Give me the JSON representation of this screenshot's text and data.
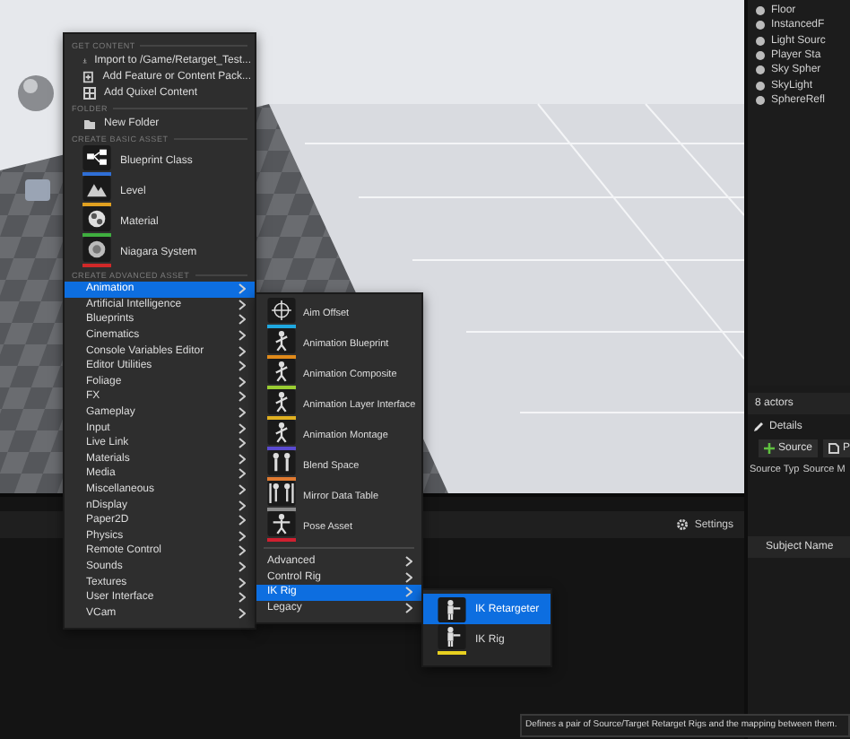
{
  "outliner": {
    "items": [
      {
        "label": "Floor"
      },
      {
        "label": "InstancedF"
      },
      {
        "label": "Light Sourc"
      },
      {
        "label": "Player Sta"
      },
      {
        "label": "Sky Spher"
      },
      {
        "label": "SkyLight"
      },
      {
        "label": "SphereRefl"
      }
    ]
  },
  "details": {
    "actor_count": "8 actors",
    "tab": "Details",
    "buttons": [
      "Source",
      "P"
    ],
    "columns": [
      "Source Typ",
      "Source M"
    ],
    "subject_header": "Subject Name"
  },
  "bottom_panel": {
    "settings": "Settings"
  },
  "context_menu": {
    "sections": [
      {
        "header": "GET CONTENT",
        "items": [
          {
            "kind": "action",
            "label": "Import to /Game/Retarget_Test..."
          },
          {
            "kind": "action",
            "label": "Add Feature or Content Pack..."
          },
          {
            "kind": "action",
            "label": "Add Quixel Content"
          }
        ]
      },
      {
        "header": "FOLDER",
        "items": [
          {
            "kind": "action",
            "label": "New Folder"
          }
        ]
      },
      {
        "header": "CREATE BASIC ASSET",
        "items": [
          {
            "kind": "asset",
            "label": "Blueprint Class",
            "color": "#2f6fd6"
          },
          {
            "kind": "asset",
            "label": "Level",
            "color": "#e0a020"
          },
          {
            "kind": "asset",
            "label": "Material",
            "color": "#3fae3f"
          },
          {
            "kind": "asset",
            "label": "Niagara System",
            "color": "#d02828"
          }
        ]
      },
      {
        "header": "CREATE ADVANCED ASSET",
        "items": [
          {
            "kind": "category",
            "label": "Animation",
            "selected": true
          },
          {
            "kind": "category",
            "label": "Artificial Intelligence",
            "selected": false
          },
          {
            "kind": "category",
            "label": "Blueprints",
            "selected": false
          },
          {
            "kind": "category",
            "label": "Cinematics",
            "selected": false
          },
          {
            "kind": "category",
            "label": "Console Variables Editor",
            "selected": false
          },
          {
            "kind": "category",
            "label": "Editor Utilities",
            "selected": false
          },
          {
            "kind": "category",
            "label": "Foliage",
            "selected": false
          },
          {
            "kind": "category",
            "label": "FX",
            "selected": false
          },
          {
            "kind": "category",
            "label": "Gameplay",
            "selected": false
          },
          {
            "kind": "category",
            "label": "Input",
            "selected": false
          },
          {
            "kind": "category",
            "label": "Live Link",
            "selected": false
          },
          {
            "kind": "category",
            "label": "Materials",
            "selected": false
          },
          {
            "kind": "category",
            "label": "Media",
            "selected": false
          },
          {
            "kind": "category",
            "label": "Miscellaneous",
            "selected": false
          },
          {
            "kind": "category",
            "label": "nDisplay",
            "selected": false
          },
          {
            "kind": "category",
            "label": "Paper2D",
            "selected": false
          },
          {
            "kind": "category",
            "label": "Physics",
            "selected": false
          },
          {
            "kind": "category",
            "label": "Remote Control",
            "selected": false
          },
          {
            "kind": "category",
            "label": "Sounds",
            "selected": false
          },
          {
            "kind": "category",
            "label": "Textures",
            "selected": false
          },
          {
            "kind": "category",
            "label": "User Interface",
            "selected": false
          },
          {
            "kind": "category",
            "label": "VCam",
            "selected": false
          }
        ]
      }
    ]
  },
  "animation_submenu": {
    "items": [
      {
        "kind": "asset",
        "label": "Aim Offset",
        "color": "#1fa8e0"
      },
      {
        "kind": "asset",
        "label": "Animation Blueprint",
        "color": "#e08a1a"
      },
      {
        "kind": "asset",
        "label": "Animation Composite",
        "color": "#9acd32"
      },
      {
        "kind": "asset",
        "label": "Animation Layer Interface",
        "color": "#e0b020"
      },
      {
        "kind": "asset",
        "label": "Animation Montage",
        "color": "#5a4ad0"
      },
      {
        "kind": "asset",
        "label": "Blend Space",
        "color": "#e07a30"
      },
      {
        "kind": "asset",
        "label": "Mirror Data Table",
        "color": "#8a8a8a"
      },
      {
        "kind": "asset",
        "label": "Pose Asset",
        "color": "#d02030"
      },
      {
        "kind": "category",
        "label": "Advanced",
        "selected": false
      },
      {
        "kind": "category",
        "label": "Control Rig",
        "selected": false
      },
      {
        "kind": "category",
        "label": "IK Rig",
        "selected": true
      },
      {
        "kind": "category",
        "label": "Legacy",
        "selected": false
      }
    ]
  },
  "ik_rig_submenu": {
    "items": [
      {
        "kind": "asset",
        "label": "IK Retargeter",
        "selected": true
      },
      {
        "kind": "asset",
        "label": "IK Rig",
        "selected": false,
        "color": "#e8d020"
      }
    ]
  },
  "tooltip": "Defines a pair of Source/Target Retarget Rigs and the mapping between them."
}
